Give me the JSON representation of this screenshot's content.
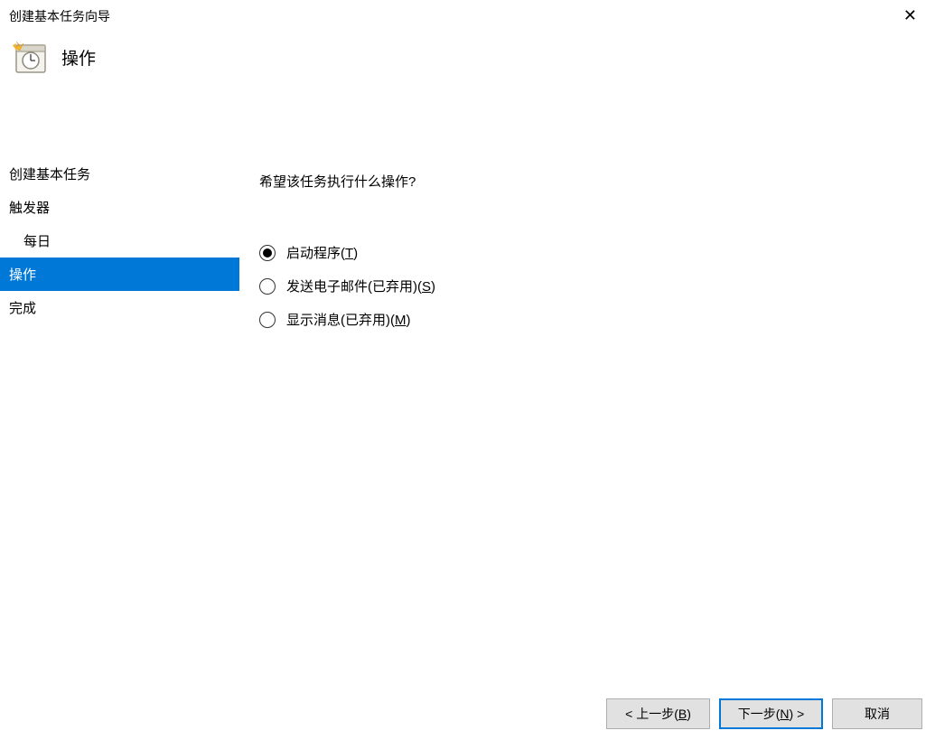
{
  "window": {
    "title": "创建基本任务向导"
  },
  "header": {
    "title": "操作"
  },
  "sidebar": {
    "items": [
      {
        "label": "创建基本任务",
        "selected": false,
        "sub": false
      },
      {
        "label": "触发器",
        "selected": false,
        "sub": false
      },
      {
        "label": "每日",
        "selected": false,
        "sub": true
      },
      {
        "label": "操作",
        "selected": true,
        "sub": false
      },
      {
        "label": "完成",
        "selected": false,
        "sub": false
      }
    ]
  },
  "content": {
    "question": "希望该任务执行什么操作?",
    "options": {
      "start_program": {
        "text": "启动程序(",
        "mn": "T",
        "suffix": ")"
      },
      "send_email": {
        "text": "发送电子邮件(已弃用)(",
        "mn": "S",
        "suffix": ")"
      },
      "show_message": {
        "text": "显示消息(已弃用)(",
        "mn": "M",
        "suffix": ")"
      }
    }
  },
  "footer": {
    "back": {
      "pre": "< 上一步(",
      "mn": "B",
      "suf": ")"
    },
    "next": {
      "pre": "下一步(",
      "mn": "N",
      "suf": ") >"
    },
    "cancel": "取消"
  }
}
